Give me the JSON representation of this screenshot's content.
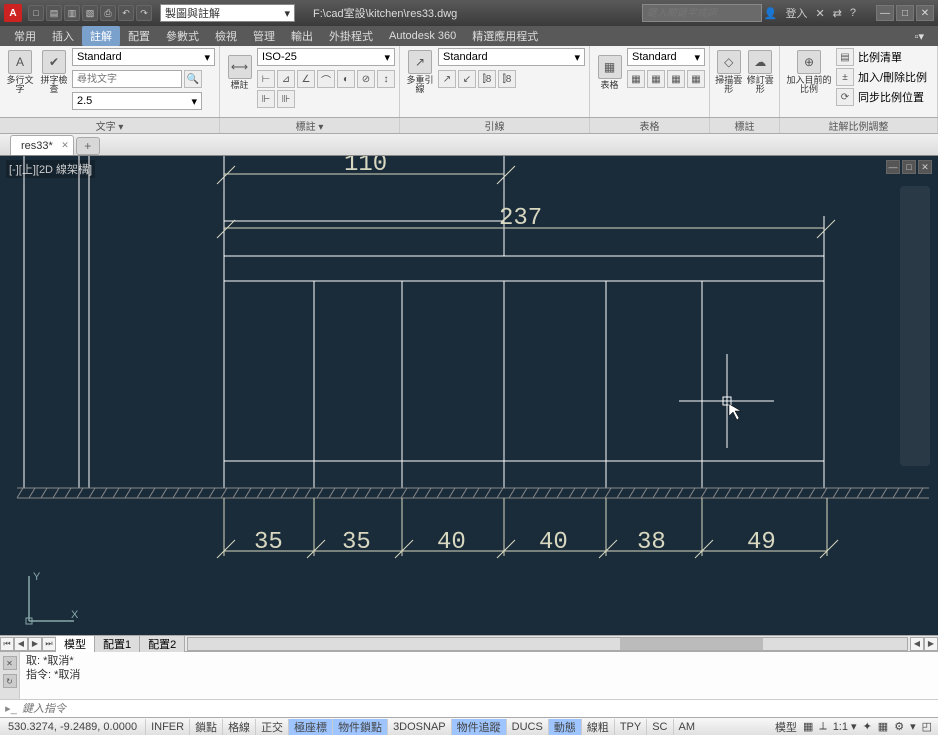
{
  "title": {
    "quick_dropdown": "製圖與註解",
    "filepath": "F:\\cad室設\\kitchen\\res33.dwg",
    "search_placeholder": "鍵入關鍵字或詞",
    "login": "登入"
  },
  "menus": [
    "常用",
    "插入",
    "註解",
    "配置",
    "參數式",
    "檢視",
    "管理",
    "輸出",
    "外掛程式",
    "Autodesk 360",
    "精選應用程式"
  ],
  "active_menu_index": 2,
  "ribbon": {
    "text_panel": {
      "style_dd": "Standard",
      "find_placeholder": "尋找文字",
      "height": "2.5",
      "large_btns": [
        "多行文字",
        "拼字檢查"
      ],
      "title": "文字 ▾"
    },
    "dim_panel": {
      "style_dd": "ISO-25",
      "large_btn": "標註",
      "title": "標註 ▾"
    },
    "leader_panel": {
      "style_dd": "Standard",
      "large_btn": "多重引線",
      "title": "引線"
    },
    "table_panel": {
      "style_dd": "Standard",
      "large_btn": "表格",
      "title": "表格"
    },
    "mark_panel": {
      "btns": [
        "掃描雲形",
        "修訂雲形"
      ],
      "title": "標註"
    },
    "scale_panel": {
      "large_btn": "加入目前的比例",
      "items": [
        "比例清單",
        "加入/刪除比例",
        "同步比例位置"
      ],
      "title": "註解比例調整"
    }
  },
  "filetab": {
    "name": "res33*"
  },
  "viewport": {
    "label": "[-][上][2D 線架構]"
  },
  "drawing": {
    "dim_top1": "110",
    "dim_top2": "237",
    "dims_bottom": [
      "35",
      "35",
      "40",
      "40",
      "38",
      "49"
    ]
  },
  "layout": {
    "tabs": [
      "模型",
      "配置1",
      "配置2"
    ]
  },
  "command": {
    "line1": "取:  *取消*",
    "line2": "指令:  *取消",
    "placeholder": "鍵入指令"
  },
  "status": {
    "coords": "530.3274, -9.2489, 0.0000",
    "toggles": [
      "INFER",
      "鎖點",
      "格線",
      "正交",
      "極座標",
      "物件鎖點",
      "3DOSNAP",
      "物件追蹤",
      "DUCS",
      "動態",
      "線粗",
      "TPY",
      "SC",
      "AM"
    ],
    "on_toggles": [
      4,
      5,
      7,
      9
    ],
    "right": [
      "模型",
      "▦",
      "⟂",
      "1:1 ▾",
      "✦",
      "▦",
      "⚙",
      "▾",
      "◰"
    ]
  }
}
